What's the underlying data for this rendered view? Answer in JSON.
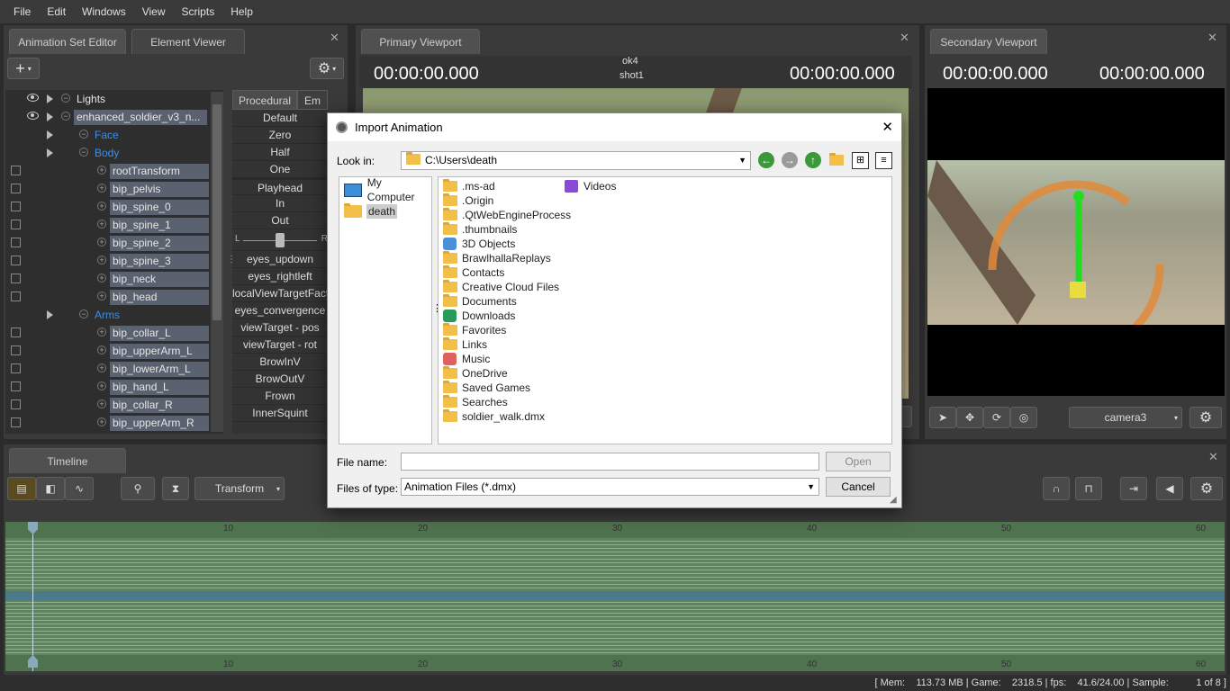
{
  "menu": [
    "File",
    "Edit",
    "Windows",
    "View",
    "Scripts",
    "Help"
  ],
  "left_panel": {
    "tabs": [
      "Animation Set Editor",
      "Element Viewer"
    ],
    "tree": [
      {
        "label": "Lights",
        "eye": true,
        "tri": true,
        "check": false,
        "indent": 0,
        "style": "plain"
      },
      {
        "label": "enhanced_soldier_v3_n...",
        "eye": true,
        "tri": true,
        "check": false,
        "indent": 0,
        "style": "sel"
      },
      {
        "label": "Face",
        "eye": false,
        "tri": true,
        "check": false,
        "indent": 1,
        "style": "grp"
      },
      {
        "label": "Body",
        "eye": false,
        "tri": true,
        "check": false,
        "indent": 1,
        "style": "grp"
      },
      {
        "label": "rootTransform",
        "check": true,
        "indent": 2,
        "style": "sel"
      },
      {
        "label": "bip_pelvis",
        "check": true,
        "indent": 2,
        "style": "sel"
      },
      {
        "label": "bip_spine_0",
        "check": true,
        "indent": 2,
        "style": "sel"
      },
      {
        "label": "bip_spine_1",
        "check": true,
        "indent": 2,
        "style": "sel"
      },
      {
        "label": "bip_spine_2",
        "check": true,
        "indent": 2,
        "style": "sel"
      },
      {
        "label": "bip_spine_3",
        "check": true,
        "indent": 2,
        "style": "sel"
      },
      {
        "label": "bip_neck",
        "check": true,
        "indent": 2,
        "style": "sel"
      },
      {
        "label": "bip_head",
        "check": true,
        "indent": 2,
        "style": "sel"
      },
      {
        "label": "Arms",
        "tri": true,
        "check": false,
        "indent": 1,
        "style": "grp"
      },
      {
        "label": "bip_collar_L",
        "check": true,
        "indent": 2,
        "style": "sel"
      },
      {
        "label": "bip_upperArm_L",
        "check": true,
        "indent": 2,
        "style": "sel"
      },
      {
        "label": "bip_lowerArm_L",
        "check": true,
        "indent": 2,
        "style": "sel"
      },
      {
        "label": "bip_hand_L",
        "check": true,
        "indent": 2,
        "style": "sel"
      },
      {
        "label": "bip_collar_R",
        "check": true,
        "indent": 2,
        "style": "sel"
      },
      {
        "label": "bip_upperArm_R",
        "check": true,
        "indent": 2,
        "style": "sel"
      }
    ],
    "ctrl_tabs": [
      "Procedural",
      "Em"
    ],
    "ctrl_rows_top": [
      "Default",
      "Zero",
      "Half",
      "One",
      "Playhead",
      "In",
      "Out"
    ],
    "slider_l": "L",
    "slider_r": "R",
    "ctrl_rows_bottom": [
      "eyes_updown",
      "eyes_rightleft",
      "localViewTargetFactor",
      "eyes_convergence",
      "viewTarget - pos",
      "viewTarget - rot",
      "BrowInV",
      "BrowOutV",
      "Frown",
      "InnerSquint"
    ]
  },
  "primary_viewport": {
    "tab": "Primary Viewport",
    "time_left": "00:00:00.000",
    "time_right": "00:00:00.000",
    "shot_line1": "ok4",
    "shot_line2": "shot1"
  },
  "secondary_viewport": {
    "tab": "Secondary Viewport",
    "time_left": "00:00:00.000",
    "time_right": "00:00:00.000",
    "camera": "camera3"
  },
  "dialog": {
    "title": "Import Animation",
    "close": "✕",
    "look_in_label": "Look in:",
    "look_in_value": "C:\\Users\\death",
    "sidebar": [
      "My Computer",
      "death"
    ],
    "files_col1": [
      ".ms-ad",
      ".Origin",
      ".QtWebEngineProcess",
      ".thumbnails",
      "3D Objects",
      "BrawlhallaReplays",
      "Contacts",
      "Creative Cloud Files",
      "Documents",
      "Downloads",
      "Favorites",
      "Links",
      "Music",
      "OneDrive",
      "Saved Games",
      "Searches",
      "soldier_walk.dmx"
    ],
    "files_col2": [
      "Videos"
    ],
    "file_name_label": "File name:",
    "file_name_value": "",
    "files_of_type_label": "Files of type:",
    "files_of_type_value": "Animation Files (*.dmx)",
    "open_button": "Open",
    "cancel_button": "Cancel"
  },
  "timeline": {
    "tab": "Timeline",
    "transform": "Transform",
    "ticks": [
      "10",
      "20",
      "30",
      "40",
      "50",
      "60"
    ]
  },
  "status": {
    "text": "[ Mem:    113.73 MB | Game:    2318.5 | fps:    41.6/24.00 | Sample:          1 of 8 ]"
  }
}
